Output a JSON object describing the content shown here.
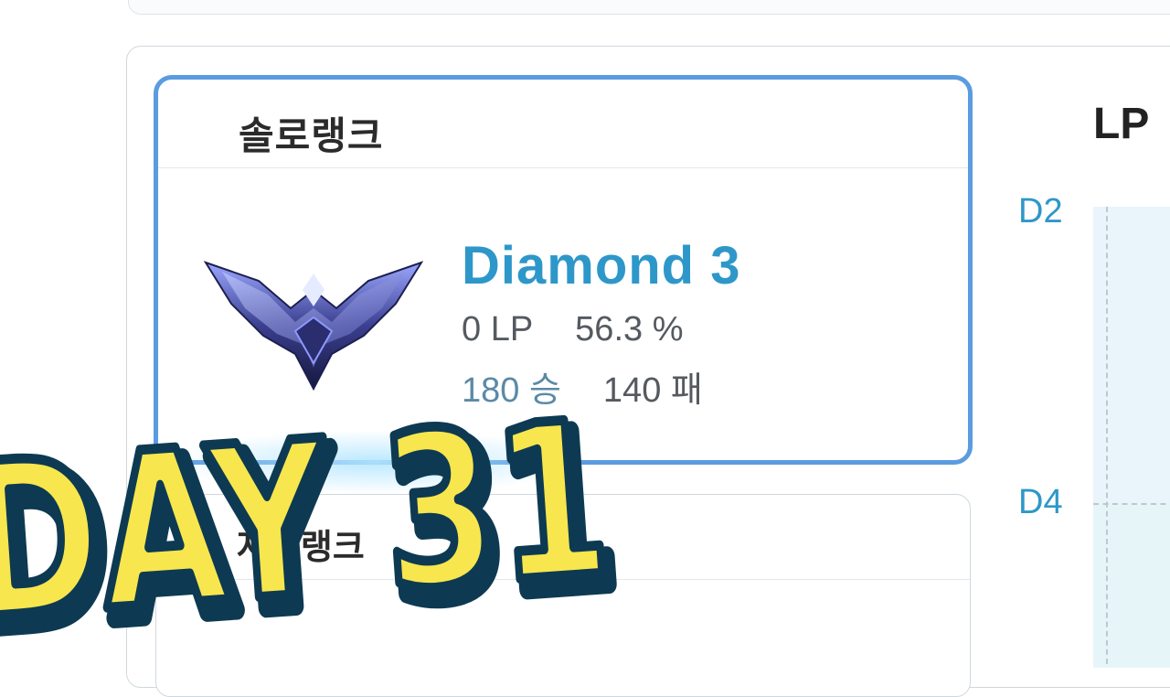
{
  "ranks": {
    "solo": {
      "title": "솔로랭크",
      "tier": "Diamond 3",
      "lp": "0 LP",
      "winrate": "56.3 %",
      "wins": "180 승",
      "losses": "140 패"
    },
    "flex": {
      "title": "자유랭크"
    }
  },
  "lp_graph": {
    "title": "LP",
    "y_labels": [
      "D2",
      "D4"
    ]
  },
  "overlay": {
    "text": "DAY 31"
  },
  "colors": {
    "accent": "#2e97c9",
    "card_border": "#5b9be0",
    "overlay_fill": "#f7e64d",
    "overlay_stroke": "#0d3a52"
  },
  "icons": {
    "emblem": "diamond-emblem-icon"
  }
}
